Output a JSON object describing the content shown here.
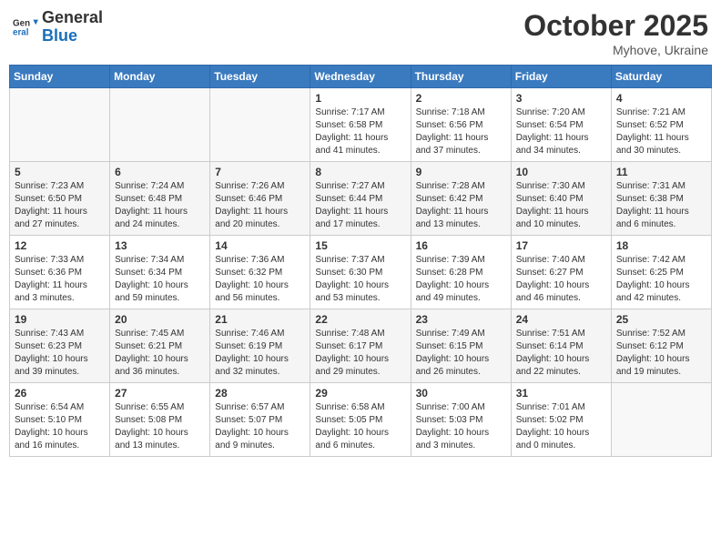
{
  "header": {
    "logo_line1": "General",
    "logo_line2": "Blue",
    "month": "October 2025",
    "location": "Myhove, Ukraine"
  },
  "weekdays": [
    "Sunday",
    "Monday",
    "Tuesday",
    "Wednesday",
    "Thursday",
    "Friday",
    "Saturday"
  ],
  "weeks": [
    [
      {
        "day": null
      },
      {
        "day": null
      },
      {
        "day": null
      },
      {
        "day": "1",
        "sunrise": "7:17 AM",
        "sunset": "6:58 PM",
        "daylight": "11 hours and 41 minutes."
      },
      {
        "day": "2",
        "sunrise": "7:18 AM",
        "sunset": "6:56 PM",
        "daylight": "11 hours and 37 minutes."
      },
      {
        "day": "3",
        "sunrise": "7:20 AM",
        "sunset": "6:54 PM",
        "daylight": "11 hours and 34 minutes."
      },
      {
        "day": "4",
        "sunrise": "7:21 AM",
        "sunset": "6:52 PM",
        "daylight": "11 hours and 30 minutes."
      }
    ],
    [
      {
        "day": "5",
        "sunrise": "7:23 AM",
        "sunset": "6:50 PM",
        "daylight": "11 hours and 27 minutes."
      },
      {
        "day": "6",
        "sunrise": "7:24 AM",
        "sunset": "6:48 PM",
        "daylight": "11 hours and 24 minutes."
      },
      {
        "day": "7",
        "sunrise": "7:26 AM",
        "sunset": "6:46 PM",
        "daylight": "11 hours and 20 minutes."
      },
      {
        "day": "8",
        "sunrise": "7:27 AM",
        "sunset": "6:44 PM",
        "daylight": "11 hours and 17 minutes."
      },
      {
        "day": "9",
        "sunrise": "7:28 AM",
        "sunset": "6:42 PM",
        "daylight": "11 hours and 13 minutes."
      },
      {
        "day": "10",
        "sunrise": "7:30 AM",
        "sunset": "6:40 PM",
        "daylight": "11 hours and 10 minutes."
      },
      {
        "day": "11",
        "sunrise": "7:31 AM",
        "sunset": "6:38 PM",
        "daylight": "11 hours and 6 minutes."
      }
    ],
    [
      {
        "day": "12",
        "sunrise": "7:33 AM",
        "sunset": "6:36 PM",
        "daylight": "11 hours and 3 minutes."
      },
      {
        "day": "13",
        "sunrise": "7:34 AM",
        "sunset": "6:34 PM",
        "daylight": "10 hours and 59 minutes."
      },
      {
        "day": "14",
        "sunrise": "7:36 AM",
        "sunset": "6:32 PM",
        "daylight": "10 hours and 56 minutes."
      },
      {
        "day": "15",
        "sunrise": "7:37 AM",
        "sunset": "6:30 PM",
        "daylight": "10 hours and 53 minutes."
      },
      {
        "day": "16",
        "sunrise": "7:39 AM",
        "sunset": "6:28 PM",
        "daylight": "10 hours and 49 minutes."
      },
      {
        "day": "17",
        "sunrise": "7:40 AM",
        "sunset": "6:27 PM",
        "daylight": "10 hours and 46 minutes."
      },
      {
        "day": "18",
        "sunrise": "7:42 AM",
        "sunset": "6:25 PM",
        "daylight": "10 hours and 42 minutes."
      }
    ],
    [
      {
        "day": "19",
        "sunrise": "7:43 AM",
        "sunset": "6:23 PM",
        "daylight": "10 hours and 39 minutes."
      },
      {
        "day": "20",
        "sunrise": "7:45 AM",
        "sunset": "6:21 PM",
        "daylight": "10 hours and 36 minutes."
      },
      {
        "day": "21",
        "sunrise": "7:46 AM",
        "sunset": "6:19 PM",
        "daylight": "10 hours and 32 minutes."
      },
      {
        "day": "22",
        "sunrise": "7:48 AM",
        "sunset": "6:17 PM",
        "daylight": "10 hours and 29 minutes."
      },
      {
        "day": "23",
        "sunrise": "7:49 AM",
        "sunset": "6:15 PM",
        "daylight": "10 hours and 26 minutes."
      },
      {
        "day": "24",
        "sunrise": "7:51 AM",
        "sunset": "6:14 PM",
        "daylight": "10 hours and 22 minutes."
      },
      {
        "day": "25",
        "sunrise": "7:52 AM",
        "sunset": "6:12 PM",
        "daylight": "10 hours and 19 minutes."
      }
    ],
    [
      {
        "day": "26",
        "sunrise": "6:54 AM",
        "sunset": "5:10 PM",
        "daylight": "10 hours and 16 minutes."
      },
      {
        "day": "27",
        "sunrise": "6:55 AM",
        "sunset": "5:08 PM",
        "daylight": "10 hours and 13 minutes."
      },
      {
        "day": "28",
        "sunrise": "6:57 AM",
        "sunset": "5:07 PM",
        "daylight": "10 hours and 9 minutes."
      },
      {
        "day": "29",
        "sunrise": "6:58 AM",
        "sunset": "5:05 PM",
        "daylight": "10 hours and 6 minutes."
      },
      {
        "day": "30",
        "sunrise": "7:00 AM",
        "sunset": "5:03 PM",
        "daylight": "10 hours and 3 minutes."
      },
      {
        "day": "31",
        "sunrise": "7:01 AM",
        "sunset": "5:02 PM",
        "daylight": "10 hours and 0 minutes."
      },
      {
        "day": null
      }
    ]
  ]
}
